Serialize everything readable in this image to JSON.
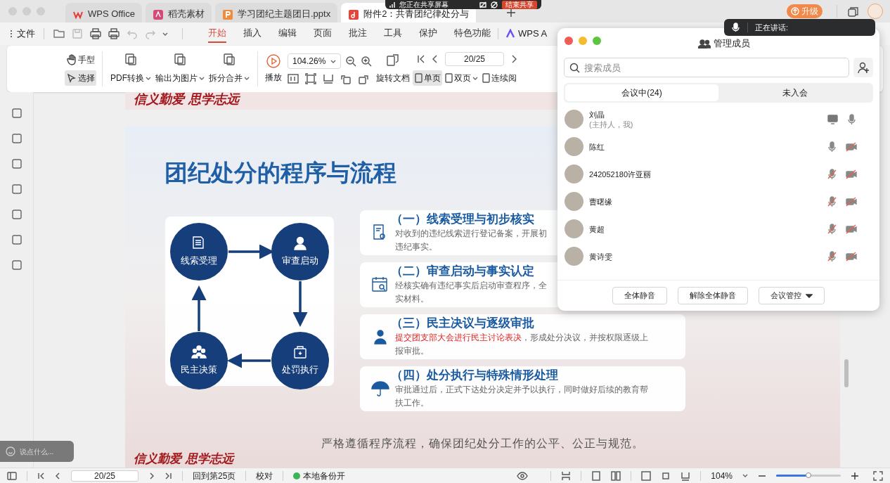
{
  "share_bar": {
    "text": "您正在共享屏幕",
    "stop": "结束共享"
  },
  "tabs": [
    {
      "label": "WPS Office",
      "kind": "wps",
      "selected": false
    },
    {
      "label": "稻壳素材",
      "kind": "docer",
      "selected": false
    },
    {
      "label": "学习团纪主题团日.pptx",
      "kind": "ppt",
      "selected": false
    },
    {
      "label": "附件2：共青团纪律处分与",
      "kind": "pdf",
      "selected": true
    }
  ],
  "upgrade": "升级",
  "menu": {
    "file": "文件",
    "tabs": [
      {
        "label": "开始",
        "selected": true
      },
      {
        "label": "插入",
        "selected": false
      },
      {
        "label": "编辑",
        "selected": false
      },
      {
        "label": "页面",
        "selected": false
      },
      {
        "label": "批注",
        "selected": false
      },
      {
        "label": "工具",
        "selected": false
      },
      {
        "label": "保护",
        "selected": false
      },
      {
        "label": "特色功能",
        "selected": false
      }
    ],
    "ai": "WPS A"
  },
  "ribbon": {
    "tools": [
      {
        "label": "手型",
        "selected": false
      },
      {
        "label": "选择",
        "selected": true
      }
    ],
    "convert": [
      "PDF转换",
      "输出为图片",
      "拆分合并"
    ],
    "play": "播放",
    "zoom": "104.26%",
    "rotate": "旋转文档",
    "page": "20/25",
    "views": [
      {
        "label": "单页",
        "selected": true,
        "dropdown": false
      },
      {
        "label": "双页",
        "selected": false,
        "dropdown": true
      },
      {
        "label": "连续阅",
        "selected": false,
        "dropdown": false
      }
    ]
  },
  "document": {
    "prev_slogan": "信义勤爱 思学志远",
    "slide": {
      "title": "团纪处分的程序与流程",
      "nodes": [
        {
          "label": "线索受理",
          "kind": "document"
        },
        {
          "label": "审查启动",
          "kind": "person"
        },
        {
          "label": "民主决策",
          "kind": "group"
        },
        {
          "label": "处罚执行",
          "kind": "box"
        }
      ],
      "steps": [
        {
          "title": "（一）线索受理与初步核实",
          "kind": "doc-search",
          "lines": [
            "对收到的违纪线索进行登记备案，开展初",
            "违纪事实。"
          ]
        },
        {
          "title": "（二）审查启动与事实认定",
          "kind": "calendar",
          "lines": [
            "经核实确有违纪事实后启动审查程序，全",
            "实材料。"
          ]
        },
        {
          "title": "（三）民主决议与逐级审批",
          "kind": "people",
          "highlight": "提交团支部大会进行民主讨论表决",
          "lines": [
            "，形成处分决议，并按权限逐级上",
            "报审批。"
          ]
        },
        {
          "title": "（四）处分执行与特殊情形处理",
          "kind": "umbrella",
          "lines": [
            "审批通过后，正式下达处分决定并予以执行，同时做好后续的教育帮",
            "扶工作。"
          ]
        }
      ],
      "caption": "严格遵循程序流程，确保团纪处分工作的公平、公正与规范。",
      "slogan": "信义勤爱 思学志远"
    }
  },
  "chat": {
    "placeholder": "说点什么..."
  },
  "status_bar": {
    "page": "20/25",
    "back": "回到第25页",
    "proof": "校对",
    "backup": {
      "label": "本地备份开",
      "on": true
    },
    "zoom": "104%",
    "zoom_slider": {
      "level": 0.5
    }
  },
  "speaking_toast": {
    "text": "正在讲话:"
  },
  "panel": {
    "title": "管理成员",
    "search": {
      "placeholder": "搜索成员"
    },
    "tabs": [
      {
        "label": "会议中(24)",
        "selected": true
      },
      {
        "label": "未入会",
        "selected": false
      }
    ],
    "members": [
      {
        "name": "刘晶",
        "note": "(主持人，我)",
        "screen_sharing": true,
        "mic_muted": false
      },
      {
        "name": "陈红",
        "screen_sharing": false,
        "mic_muted": false
      },
      {
        "name": "242052180许亚丽",
        "screen_sharing": false,
        "mic_muted": true
      },
      {
        "name": "曹曙缘",
        "screen_sharing": false,
        "mic_muted": true
      },
      {
        "name": "黄超",
        "screen_sharing": false,
        "mic_muted": true
      },
      {
        "name": "黄诗雯",
        "screen_sharing": false,
        "mic_muted": true
      }
    ],
    "buttons": [
      {
        "label": "全体静音",
        "dropdown": false
      },
      {
        "label": "解除全体静音",
        "dropdown": false
      },
      {
        "label": "会议管控",
        "dropdown": true
      }
    ]
  }
}
